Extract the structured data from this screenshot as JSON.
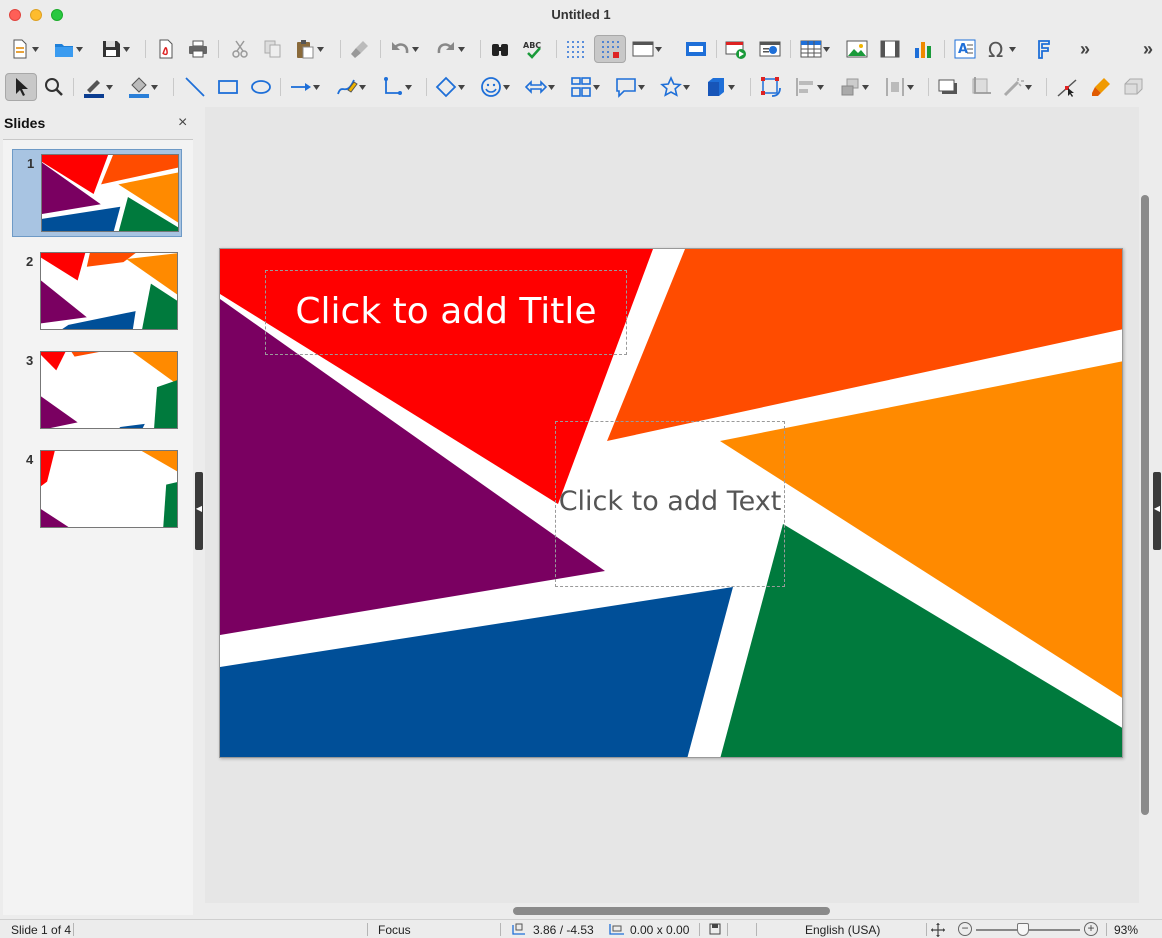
{
  "window": {
    "title": "Untitled 1"
  },
  "toolbar": {
    "overflow_1": "»",
    "overflow_2": "»"
  },
  "slides_panel": {
    "heading": "Slides",
    "close": "×",
    "slides": [
      {
        "number": "1",
        "selected": true
      },
      {
        "number": "2",
        "selected": false
      },
      {
        "number": "3",
        "selected": false
      },
      {
        "number": "4",
        "selected": false
      }
    ]
  },
  "slide": {
    "title_placeholder": "Click to add Title",
    "text_placeholder": "Click to add Text",
    "colors": {
      "red": "#ff0000",
      "orange_red": "#ff4c00",
      "orange": "#ff8a00",
      "purple": "#7a0061",
      "blue": "#004f98",
      "green": "#007a3d"
    }
  },
  "statusbar": {
    "slide_position": "Slide 1 of 4",
    "layout": "Focus",
    "position": "3.86 / -4.53",
    "size": "0.00 x 0.00",
    "language": "English (USA)",
    "zoom": "93%",
    "zoom_minus": "−",
    "zoom_plus": "+"
  }
}
